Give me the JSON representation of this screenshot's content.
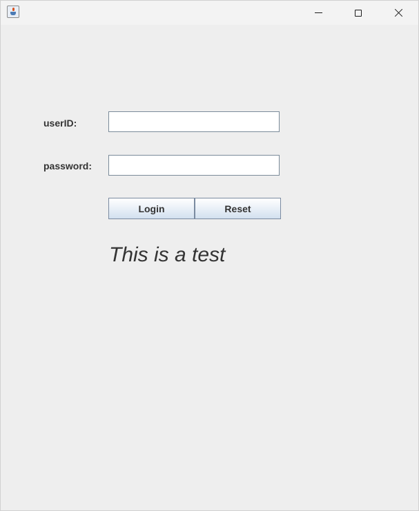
{
  "window": {
    "app_icon": "java-cup-icon",
    "controls": {
      "minimize": "minimize-icon",
      "maximize": "maximize-icon",
      "close": "close-icon"
    }
  },
  "form": {
    "userid_label": "userID:",
    "userid_value": "",
    "password_label": "password:",
    "password_value": "",
    "login_label": "Login",
    "reset_label": "Reset"
  },
  "message": "This is a test"
}
